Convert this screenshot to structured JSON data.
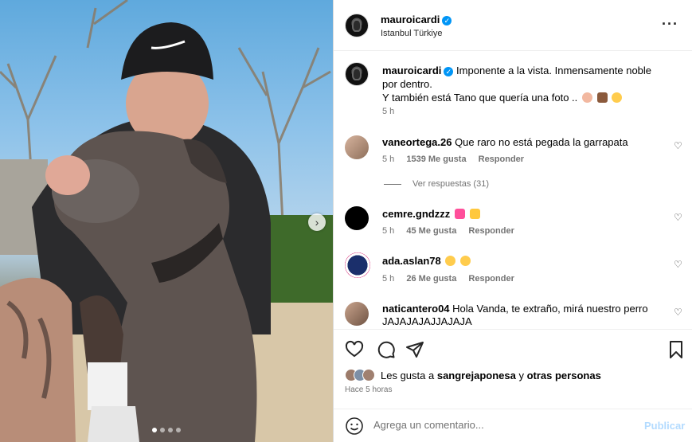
{
  "post": {
    "username": "mauroicardi",
    "location": "Istanbul Türkiye",
    "more_icon": "more-horizontal-icon",
    "carousel": {
      "slides": 4,
      "active": 1
    }
  },
  "caption": {
    "username": "mauroicardi",
    "text_line1": "Imponente a la vista. Inmensamente noble por dentro.",
    "text_line2": "Y también está Tano que quería una foto ..",
    "time": "5 h"
  },
  "comments": [
    {
      "username": "vaneortega.26",
      "text": "Que raro no está pegada la garrapata",
      "time": "5 h",
      "likes": "1539 Me gusta",
      "reply": "Responder"
    },
    {
      "username": "cemre.gndzzz",
      "text": "",
      "time": "5 h",
      "likes": "45 Me gusta",
      "reply": "Responder"
    },
    {
      "username": "ada.aslan78",
      "text": "",
      "time": "5 h",
      "likes": "26 Me gusta",
      "reply": "Responder"
    },
    {
      "username": "naticantero04",
      "text": "Hola Vanda, te extraño, mirá nuestro perro JAJAJAJAJJAJAJA"
    }
  ],
  "view_replies": "Ver respuestas (31)",
  "likes": {
    "prefix": "Les gusta a",
    "user": "sangrejaponesa",
    "connector": "y",
    "others": "otras personas"
  },
  "time_ago": "Hace 5 horas",
  "add_comment": {
    "placeholder": "Agrega un comentario...",
    "publish": "Publicar"
  },
  "colors": {
    "accent": "#0095f6",
    "publish_disabled": "#b3dbff",
    "muted": "#737373"
  }
}
